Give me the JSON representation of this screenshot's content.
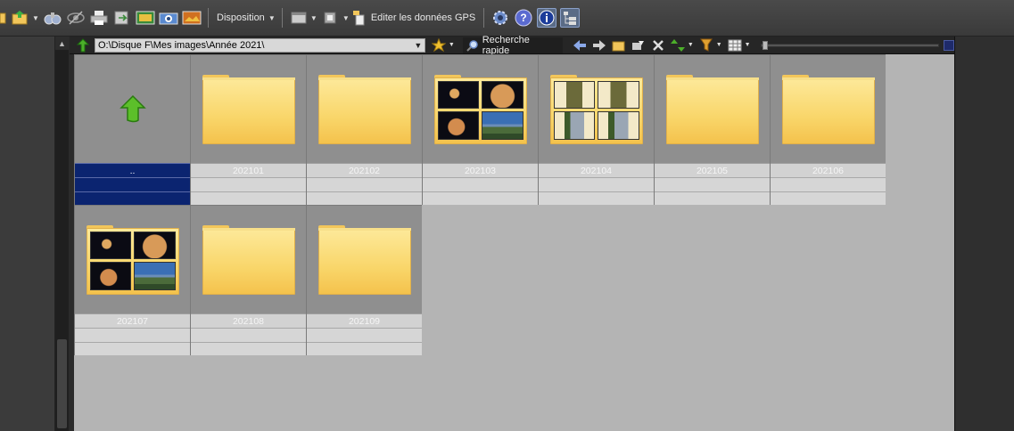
{
  "toolbar": {
    "disposition_label": "Disposition",
    "gps_label": "Editer les données GPS"
  },
  "pathbar": {
    "path": "O:\\Disque F\\Mes images\\Année 2021\\",
    "quick_search_label": "Recherche rapide"
  },
  "folders": [
    {
      "name": "..",
      "kind": "parent"
    },
    {
      "name": "202101",
      "kind": "empty"
    },
    {
      "name": "202102",
      "kind": "empty"
    },
    {
      "name": "202103",
      "kind": "photos-moon"
    },
    {
      "name": "202104",
      "kind": "photos-trees"
    },
    {
      "name": "202105",
      "kind": "empty"
    },
    {
      "name": "202106",
      "kind": "empty"
    },
    {
      "name": "202107",
      "kind": "photos-moon"
    },
    {
      "name": "202108",
      "kind": "empty"
    },
    {
      "name": "202109",
      "kind": "empty"
    }
  ],
  "colors": {
    "selection": "#0b2470",
    "folder": "#f9d66a",
    "content_bg": "#b4b4b4"
  }
}
